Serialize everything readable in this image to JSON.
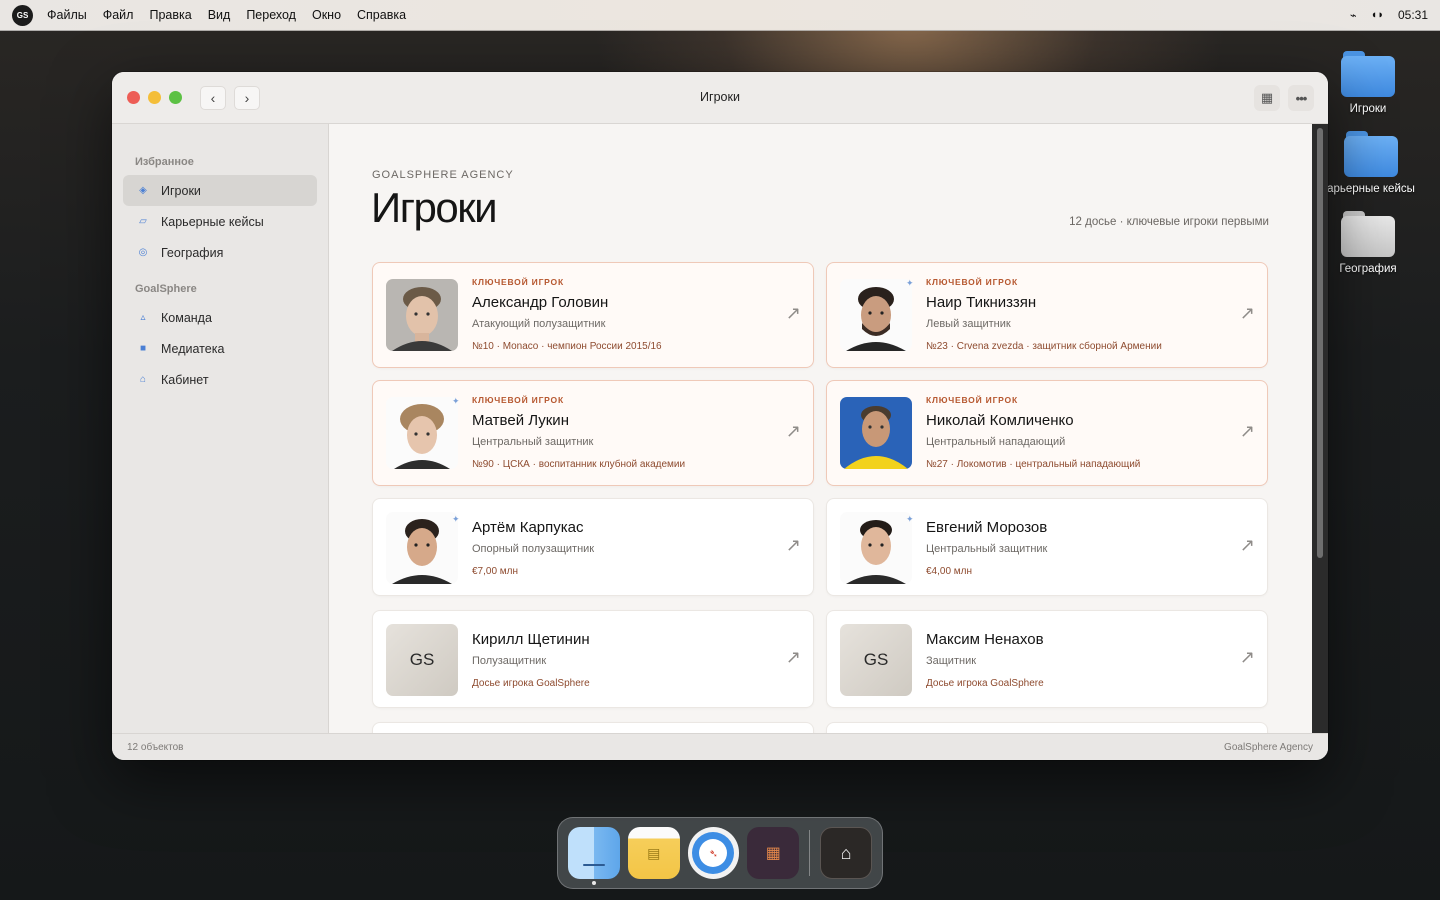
{
  "menubar": {
    "logo": "GS",
    "items": [
      "Файлы",
      "Файл",
      "Правка",
      "Вид",
      "Переход",
      "Окно",
      "Справка"
    ],
    "time": "05:31"
  },
  "desktop": {
    "icons": [
      {
        "label": "Игроки",
        "style": "blue"
      },
      {
        "label": "арьерные кейсы",
        "style": "blue"
      },
      {
        "label": "География",
        "style": "gray"
      }
    ]
  },
  "window": {
    "title": "Игроки",
    "sidebar": {
      "sections": [
        {
          "heading": "Избранное",
          "items": [
            {
              "label": "Игроки",
              "icon": "diamond-icon",
              "active": true
            },
            {
              "label": "Карьерные кейсы",
              "icon": "card-icon"
            },
            {
              "label": "География",
              "icon": "globe-icon"
            }
          ]
        },
        {
          "heading": "GoalSphere",
          "items": [
            {
              "label": "Команда",
              "icon": "team-icon"
            },
            {
              "label": "Медиатека",
              "icon": "media-icon"
            },
            {
              "label": "Кабинет",
              "icon": "home-icon"
            }
          ]
        }
      ]
    },
    "main": {
      "eyebrow": "GOALSPHERE AGENCY",
      "title": "Игроки",
      "meta": "12 досье · ключевые игроки первыми",
      "players": [
        {
          "badge": "ключевой игрок",
          "name": "Александр Головин",
          "position": "Атакующий полузащитник",
          "note": "№10 · Monaco · чемпион России 2015/16",
          "avatar": "photo-light"
        },
        {
          "badge": "ключевой игрок",
          "name": "Наир Тикниззян",
          "position": "Левый защитник",
          "note": "№23 · Crvena zvezda · защитник сборной Армении",
          "avatar": "photo-dark"
        },
        {
          "badge": "ключевой игрок",
          "name": "Матвей Лукин",
          "position": "Центральный защитник",
          "note": "№90 · ЦСКА · воспитанник клубной академии",
          "avatar": "photo-curly"
        },
        {
          "badge": "ключевой игрок",
          "name": "Николай Комличенко",
          "position": "Центральный нападающий",
          "note": "№27 · Локомотив · центральный нападающий",
          "avatar": "photo-kit"
        },
        {
          "badge": "",
          "name": "Артём Карпукас",
          "position": "Опорный полузащитник",
          "note": "€7,00 млн",
          "avatar": "photo-dark"
        },
        {
          "badge": "",
          "name": "Евгений Морозов",
          "position": "Центральный защитник",
          "note": "€4,00 млн",
          "avatar": "photo-dark"
        },
        {
          "badge": "",
          "name": "Кирилл Щетинин",
          "position": "Полузащитник",
          "note": "Досье игрока GoalSphere",
          "avatar": "GS"
        },
        {
          "badge": "",
          "name": "Максим Ненахов",
          "position": "Защитник",
          "note": "Досье игрока GoalSphere",
          "avatar": "GS"
        }
      ]
    },
    "status": {
      "left": "12 объектов",
      "right": "GoalSphere Agency"
    }
  },
  "dock": {
    "apps": [
      "finder-icon",
      "notes-icon",
      "safari-icon",
      "books-icon",
      "home-icon"
    ]
  }
}
